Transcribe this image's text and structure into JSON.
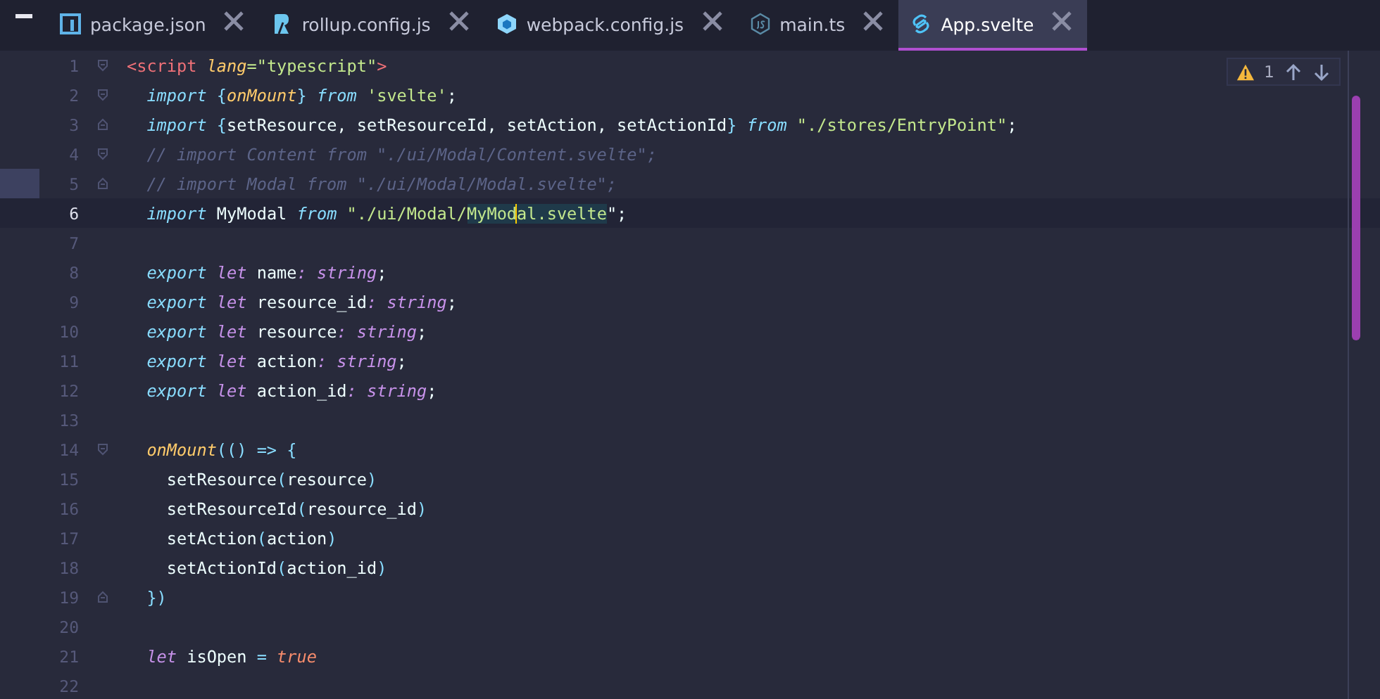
{
  "tabs": [
    {
      "label": "package.json",
      "selected": false
    },
    {
      "label": "rollup.config.js",
      "selected": false
    },
    {
      "label": "webpack.config.js",
      "selected": false
    },
    {
      "label": "main.ts",
      "selected": false
    },
    {
      "label": "App.svelte",
      "selected": true
    }
  ],
  "inspection": {
    "warnings": "1"
  },
  "lines": [
    {
      "number": "1",
      "current": false,
      "marked": false,
      "fold_start": true,
      "fold_end": false,
      "tokens": [
        {
          "text": "<script",
          "kind": "tag"
        },
        {
          "text": " lang",
          "kind": "attr"
        },
        {
          "text": "=\"typescript\"",
          "kind": "str"
        },
        {
          "text": ">",
          "kind": "tag"
        }
      ]
    },
    {
      "number": "2",
      "current": false,
      "marked": false,
      "fold_start": true,
      "fold_end": false,
      "tokens": [
        {
          "text": "  import",
          "kind": "kw"
        },
        {
          "text": " {",
          "kind": "punct"
        },
        {
          "text": "onMount",
          "kind": "fn"
        },
        {
          "text": "}",
          "kind": "punct"
        },
        {
          "text": " from",
          "kind": "kw"
        },
        {
          "text": " 'svelte'",
          "kind": "str"
        },
        {
          "text": ";",
          "kind": "plain"
        }
      ]
    },
    {
      "number": "3",
      "current": false,
      "marked": false,
      "fold_start": false,
      "fold_end": true,
      "tokens": [
        {
          "text": "  import",
          "kind": "kw"
        },
        {
          "text": " {",
          "kind": "punct"
        },
        {
          "text": "setResource, setResourceId, setAction, setActionId",
          "kind": "plain"
        },
        {
          "text": "}",
          "kind": "punct"
        },
        {
          "text": " from",
          "kind": "kw"
        },
        {
          "text": " \"./stores/EntryPoint\"",
          "kind": "str"
        },
        {
          "text": ";",
          "kind": "plain"
        }
      ]
    },
    {
      "number": "4",
      "current": false,
      "marked": false,
      "fold_start": true,
      "fold_end": false,
      "tokens": [
        {
          "text": "  // import Content from \"./ui/Modal/Content.svelte\";",
          "kind": "comment"
        }
      ]
    },
    {
      "number": "5",
      "current": false,
      "marked": true,
      "fold_start": false,
      "fold_end": true,
      "tokens": [
        {
          "text": "  // import Modal from \"./ui/Modal/Modal.svelte\";",
          "kind": "comment"
        }
      ]
    },
    {
      "number": "6",
      "current": true,
      "marked": false,
      "fold_start": false,
      "fold_end": false,
      "tokens": [
        {
          "text": "  import",
          "kind": "kw"
        },
        {
          "text": " MyModal",
          "kind": "plain"
        },
        {
          "text": " from",
          "kind": "kw"
        },
        {
          "text": " \"./ui/Modal/",
          "kind": "str"
        },
        {
          "text": "MyMod",
          "kind": "sel",
          "caret": true
        },
        {
          "text": "al.svelte",
          "kind": "sel"
        },
        {
          "text": "\";",
          "kind": "plain"
        }
      ]
    },
    {
      "number": "7",
      "current": false,
      "marked": false,
      "fold_start": false,
      "fold_end": false
    },
    {
      "number": "8",
      "current": false,
      "marked": false,
      "fold_start": false,
      "fold_end": false,
      "tokens": [
        {
          "text": "  export",
          "kind": "kw"
        },
        {
          "text": " let",
          "kind": "kw2"
        },
        {
          "text": " name",
          "kind": "plain"
        },
        {
          "text": ": string",
          "kind": "type"
        },
        {
          "text": ";",
          "kind": "plain"
        }
      ]
    },
    {
      "number": "9",
      "current": false,
      "marked": false,
      "fold_start": false,
      "fold_end": false,
      "tokens": [
        {
          "text": "  export",
          "kind": "kw"
        },
        {
          "text": " let",
          "kind": "kw2"
        },
        {
          "text": " resource_id",
          "kind": "plain"
        },
        {
          "text": ": string",
          "kind": "type"
        },
        {
          "text": ";",
          "kind": "plain"
        }
      ]
    },
    {
      "number": "10",
      "current": false,
      "marked": false,
      "fold_start": false,
      "fold_end": false,
      "tokens": [
        {
          "text": "  export",
          "kind": "kw"
        },
        {
          "text": " let",
          "kind": "kw2"
        },
        {
          "text": " resource",
          "kind": "plain"
        },
        {
          "text": ": string",
          "kind": "type"
        },
        {
          "text": ";",
          "kind": "plain"
        }
      ]
    },
    {
      "number": "11",
      "current": false,
      "marked": false,
      "fold_start": false,
      "fold_end": false,
      "tokens": [
        {
          "text": "  export",
          "kind": "kw"
        },
        {
          "text": " let",
          "kind": "kw2"
        },
        {
          "text": " action",
          "kind": "plain"
        },
        {
          "text": ": string",
          "kind": "type"
        },
        {
          "text": ";",
          "kind": "plain"
        }
      ]
    },
    {
      "number": "12",
      "current": false,
      "marked": false,
      "fold_start": false,
      "fold_end": false,
      "tokens": [
        {
          "text": "  export",
          "kind": "kw"
        },
        {
          "text": " let",
          "kind": "kw2"
        },
        {
          "text": " action_id",
          "kind": "plain"
        },
        {
          "text": ": string",
          "kind": "type"
        },
        {
          "text": ";",
          "kind": "plain"
        }
      ]
    },
    {
      "number": "13",
      "current": false,
      "marked": false,
      "fold_start": false,
      "fold_end": false
    },
    {
      "number": "14",
      "current": false,
      "marked": false,
      "fold_start": true,
      "fold_end": false,
      "tokens": [
        {
          "text": "  onMount",
          "kind": "fn"
        },
        {
          "text": "(() => {",
          "kind": "punct"
        }
      ]
    },
    {
      "number": "15",
      "current": false,
      "marked": false,
      "fold_start": false,
      "fold_end": false,
      "tokens": [
        {
          "text": "    setResource",
          "kind": "plain"
        },
        {
          "text": "(",
          "kind": "punct"
        },
        {
          "text": "resource",
          "kind": "plain"
        },
        {
          "text": ")",
          "kind": "punct"
        }
      ]
    },
    {
      "number": "16",
      "current": false,
      "marked": false,
      "fold_start": false,
      "fold_end": false,
      "tokens": [
        {
          "text": "    setResourceId",
          "kind": "plain"
        },
        {
          "text": "(",
          "kind": "punct"
        },
        {
          "text": "resource_id",
          "kind": "plain"
        },
        {
          "text": ")",
          "kind": "punct"
        }
      ]
    },
    {
      "number": "17",
      "current": false,
      "marked": false,
      "fold_start": false,
      "fold_end": false,
      "tokens": [
        {
          "text": "    setAction",
          "kind": "plain"
        },
        {
          "text": "(",
          "kind": "punct"
        },
        {
          "text": "action",
          "kind": "plain"
        },
        {
          "text": ")",
          "kind": "punct"
        }
      ]
    },
    {
      "number": "18",
      "current": false,
      "marked": false,
      "fold_start": false,
      "fold_end": false,
      "tokens": [
        {
          "text": "    setActionId",
          "kind": "plain"
        },
        {
          "text": "(",
          "kind": "punct"
        },
        {
          "text": "action_id",
          "kind": "plain"
        },
        {
          "text": ")",
          "kind": "punct"
        }
      ]
    },
    {
      "number": "19",
      "current": false,
      "marked": false,
      "fold_start": false,
      "fold_end": true,
      "tokens": [
        {
          "text": "  })",
          "kind": "punct"
        }
      ]
    },
    {
      "number": "20",
      "current": false,
      "marked": false,
      "fold_start": false,
      "fold_end": false
    },
    {
      "number": "21",
      "current": false,
      "marked": false,
      "fold_start": false,
      "fold_end": false,
      "tokens": [
        {
          "text": "  let",
          "kind": "kw2"
        },
        {
          "text": " isOpen ",
          "kind": "plain"
        },
        {
          "text": "=",
          "kind": "punct"
        },
        {
          "text": " true",
          "kind": "bool"
        }
      ]
    },
    {
      "number": "22",
      "current": false,
      "marked": false,
      "fold_start": false,
      "fold_end": false
    }
  ]
}
